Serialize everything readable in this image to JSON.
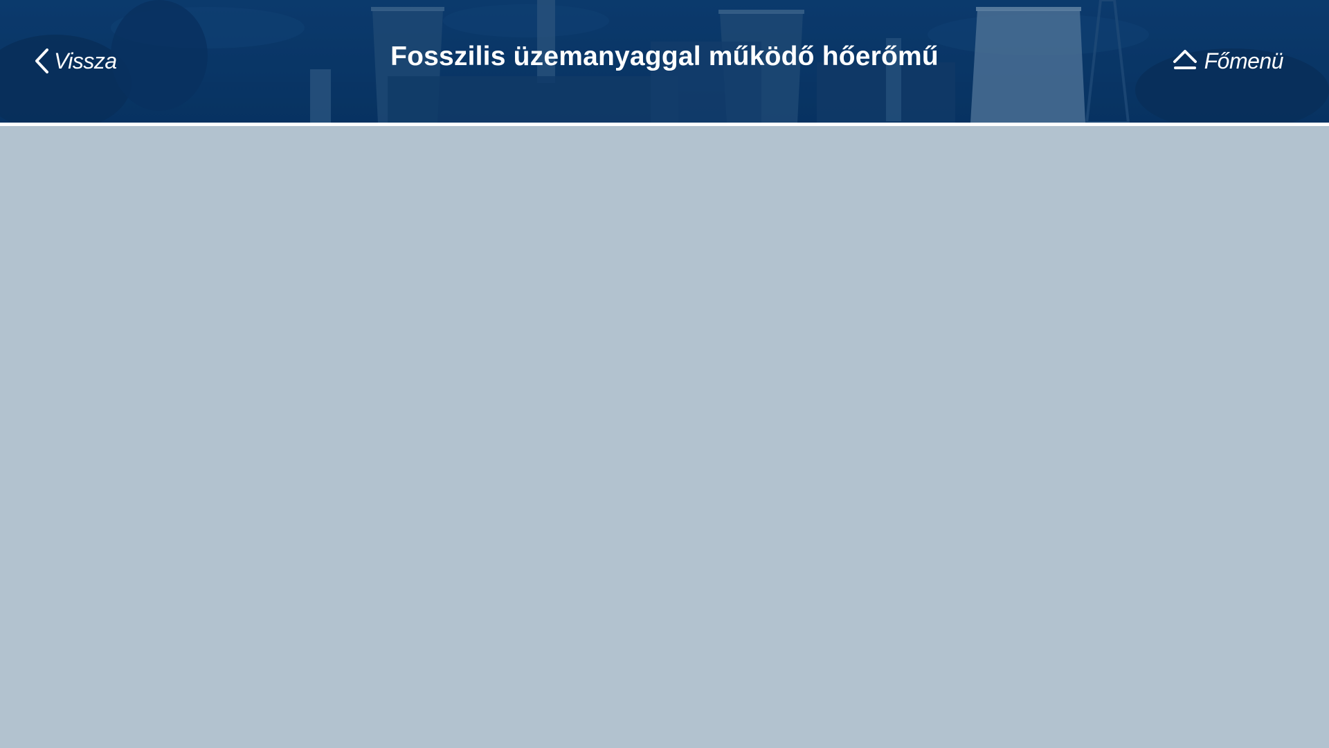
{
  "header": {
    "title": "Fosszilis üzemanyaggal működő hőerőmű",
    "back_label": "Vissza",
    "home_label": "Főmenü",
    "background_image": "power-plant-photo"
  },
  "colors": {
    "header_overlay": "#0b3a6e",
    "content_background": "#b2c2cf",
    "divider": "#ffffff",
    "text": "#ffffff"
  },
  "icons": {
    "back": "chevron-left-icon",
    "home": "eject-home-icon"
  }
}
